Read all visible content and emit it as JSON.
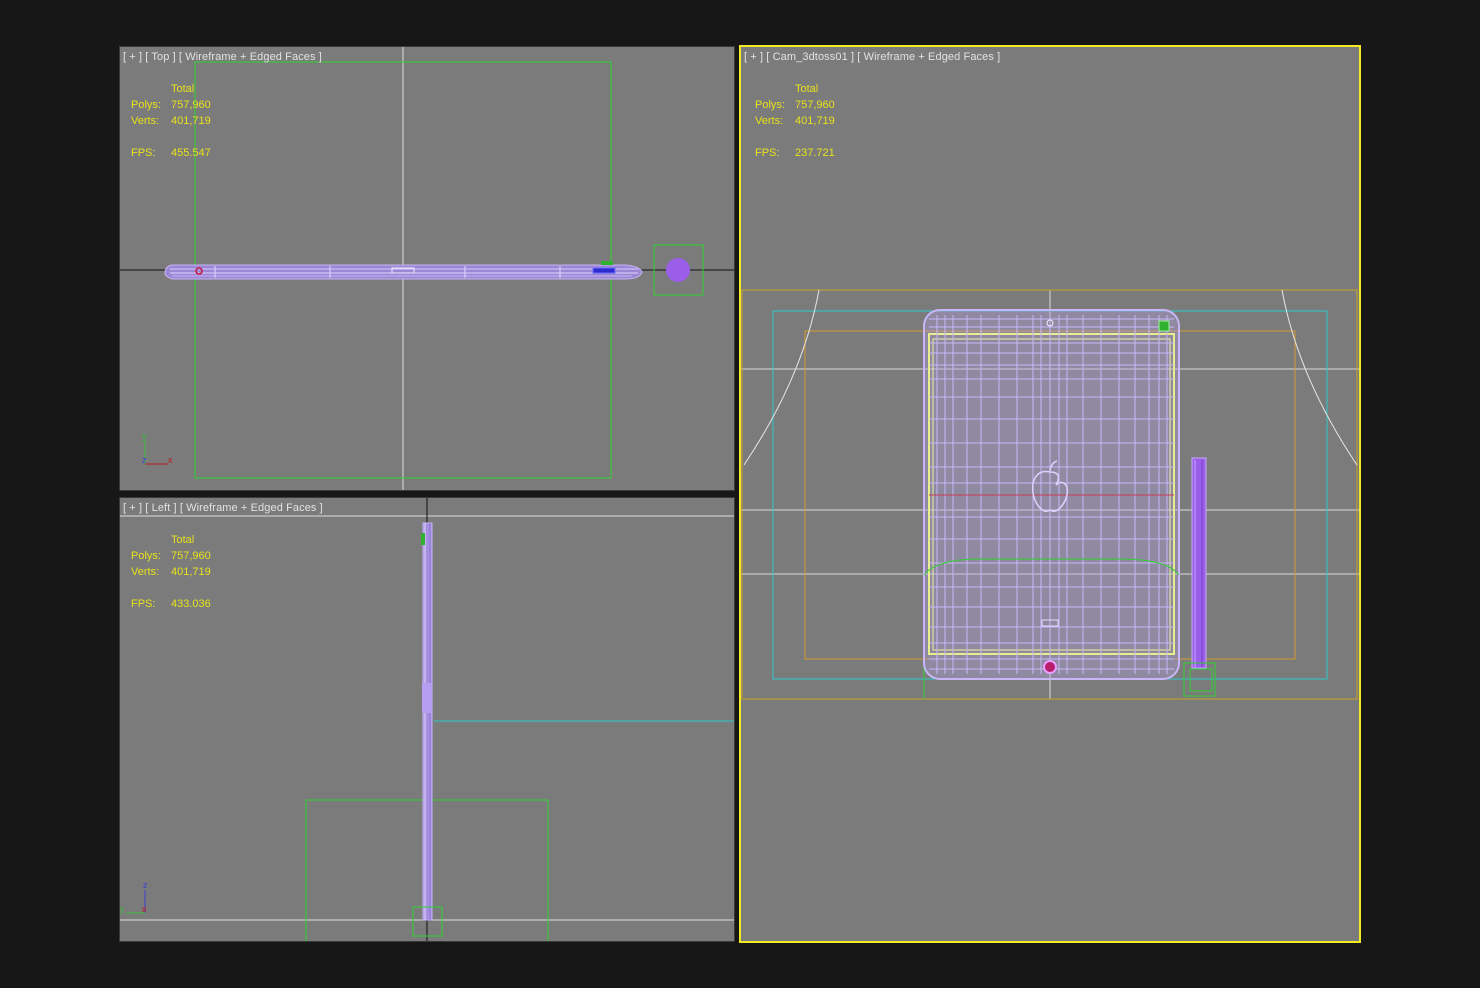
{
  "viewports": {
    "top": {
      "label": "[ + ] [ Top ] [ Wireframe + Edged Faces ]",
      "stats": {
        "header": "Total",
        "polys_label": "Polys:",
        "polys": "757,960",
        "verts_label": "Verts:",
        "verts": "401,719",
        "fps_label": "FPS:",
        "fps": "455.547"
      },
      "axis": {
        "y": "y",
        "z": "z",
        "x": "x"
      }
    },
    "left": {
      "label": "[ + ] [ Left ] [ Wireframe + Edged Faces ]",
      "stats": {
        "header": "Total",
        "polys_label": "Polys:",
        "polys": "757,960",
        "verts_label": "Verts:",
        "verts": "401,719",
        "fps_label": "FPS:",
        "fps": "433.036"
      },
      "axis": {
        "z": "z",
        "y": "y",
        "x": "x"
      }
    },
    "camera": {
      "label": "[ + ] [ Cam_3dtoss01 ] [ Wireframe + Edged Faces ]",
      "stats": {
        "header": "Total",
        "polys_label": "Polys:",
        "polys": "757,960",
        "verts_label": "Verts:",
        "verts": "401,719",
        "fps_label": "FPS:",
        "fps": "237.721"
      }
    }
  },
  "colors": {
    "background": "#171717",
    "viewport": "#7b7b7b",
    "active_border": "#f2ea24",
    "stats_text": "#e7e21b",
    "wireframe": "#b9a0ee",
    "selection_box": "#2fd12f",
    "camera_frustum": "#2fc9c9",
    "safe_frame": "#d49a2e"
  }
}
